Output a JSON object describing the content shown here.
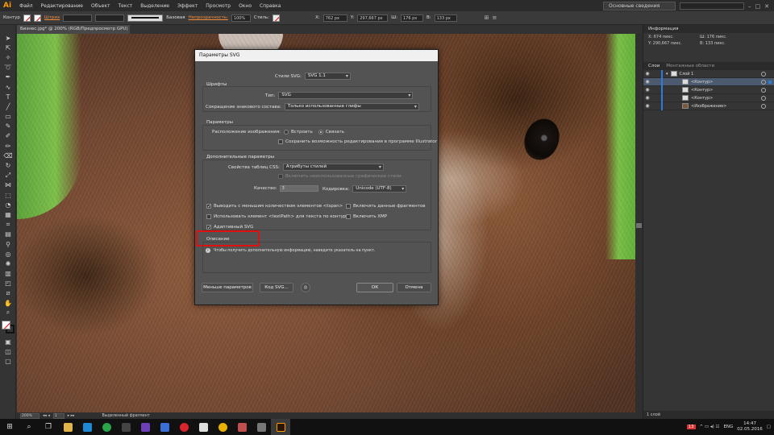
{
  "menubar": {
    "logo": "Ai",
    "items": [
      "Файл",
      "Редактирование",
      "Объект",
      "Текст",
      "Выделение",
      "Эффект",
      "Просмотр",
      "Окно",
      "Справка"
    ],
    "workspace": "Основные сведения"
  },
  "controlbar": {
    "label": "Контур",
    "stroke_label": "Штрих",
    "stroke_style": "Базовая",
    "opacity_label": "Непрозрачность:",
    "opacity_value": "100%",
    "style_label": "Стиль:",
    "x_label": "X:",
    "x_value": "762 px",
    "y_label": "Y:",
    "y_value": "297,667 px",
    "w_label": "Ш:",
    "w_value": "176 px",
    "h_label": "В:",
    "h_value": "133 px"
  },
  "document_tab": "Бизнес.jpg* @ 200% (RGB/Предпросмотр GPU)",
  "statusbar": {
    "zoom": "200%",
    "page": "1",
    "status": "Выделенный фрагмент"
  },
  "info_panel": {
    "title": "Информация",
    "x": "674 пикс.",
    "y": "290,667 пикс.",
    "w": "176 пикс.",
    "h": "133 пикс.",
    "x_lbl": "X:",
    "y_lbl": "Y:",
    "w_lbl": "Ш:",
    "h_lbl": "В:"
  },
  "layers_panel": {
    "tabs": [
      "Слои",
      "Монтажные области"
    ],
    "rows": [
      "Слой 1",
      "<Контур>",
      "<Контур>",
      "<Контур>",
      "<Изображение>"
    ],
    "footer": "1 слой"
  },
  "dialog": {
    "title": "Параметры SVG",
    "svg_profile_label": "Стили SVG:",
    "svg_profile_value": "SVG 1.1",
    "fonts_group": "Шрифты",
    "type_label": "Тип:",
    "type_value": "SVG",
    "subset_label": "Сокращение знакового состава:",
    "subset_value": "Только использованные глифы",
    "options_group": "Параметры",
    "image_loc_label": "Расположение изображения:",
    "embed_label": "Встроить",
    "link_label": "Связать",
    "preserve_label": "Сохранить возможность редактирования в программе Illustrator",
    "advanced_group": "Дополнительные параметры",
    "css_label": "Свойства таблиц CSS:",
    "css_value": "Атрибуты стилей",
    "unused_label": "Включить неиспользованные графические стили",
    "quality_label": "Качество:",
    "quality_value": "3",
    "encoding_label": "Кодировка:",
    "encoding_value": "Unicode (UTF-8)",
    "tspan_label": "Выводить с меньшим количеством элементов <tspan>",
    "slicing_label": "Включить данные фрагментов",
    "textpath_label": "Использовать элемент <textPath> для текста по контуру",
    "xmp_label": "Включить XMP",
    "responsive_label": "Адаптивный SVG",
    "description_group": "Описание",
    "description_text": "Чтобы получить дополнительную информацию, наведите указатель на пункт.",
    "fewer_button": "Меньше параметров",
    "code_button": "Код SVG...",
    "ok_button": "ОК",
    "cancel_button": "Отмена"
  },
  "taskbar": {
    "lang": "ENG",
    "time": "14:47",
    "date": "02.05.2016",
    "badge": "13"
  }
}
